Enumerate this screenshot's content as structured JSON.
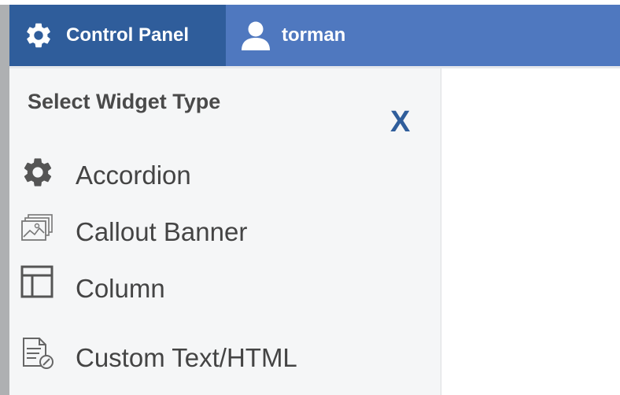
{
  "topbar": {
    "control_panel_label": "Control Panel",
    "username": "torman",
    "color_primary": "#4f78bf",
    "color_active": "#2f5d9b"
  },
  "panel": {
    "title": "Select Widget Type",
    "close_label": "X",
    "items": [
      {
        "label": "Accordion",
        "icon": "gear-icon"
      },
      {
        "label": "Callout Banner",
        "icon": "image-stack-icon"
      },
      {
        "label": "Column",
        "icon": "column-layout-icon"
      },
      {
        "label": "Custom Text/HTML",
        "icon": "document-edit-icon"
      }
    ]
  }
}
